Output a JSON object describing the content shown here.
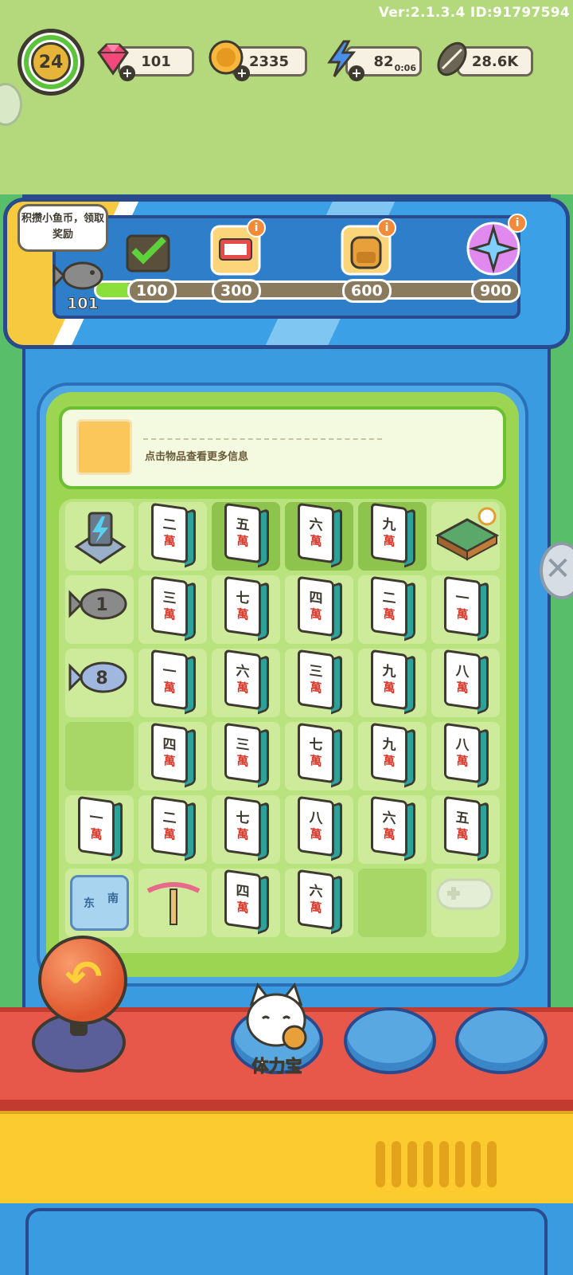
{
  "version": "Ver:2.1.3.4 ID:91797594",
  "player": {
    "level": "24"
  },
  "stats": {
    "gems": "101",
    "coins": "2335",
    "energy": "82",
    "energy_timer": "0:06",
    "seeds": "28.6K"
  },
  "reward_track": {
    "tip": "积攒小鱼币，领取奖励",
    "fish_count": "101",
    "milestones": [
      "100",
      "300",
      "600",
      "900"
    ],
    "progress_fraction": 0.06
  },
  "info_panel": {
    "hint": "点击物品查看更多信息"
  },
  "board": {
    "wan_label": "萬",
    "rows": [
      [
        "charger",
        "二",
        "五",
        "六",
        "九",
        "mahjong-table"
      ],
      [
        "fish-1",
        "三",
        "七",
        "四",
        "二",
        "一"
      ],
      [
        "fish-8",
        "一",
        "六",
        "三",
        "九",
        "八"
      ],
      [
        "empty",
        "四",
        "三",
        "七",
        "九",
        "八"
      ],
      [
        "一",
        "二",
        "七",
        "八",
        "六",
        "五"
      ],
      [
        "fortune-teller",
        "bamboo-dragonfly",
        "四",
        "六",
        "empty",
        "gamepad"
      ]
    ],
    "fortune_teller_labels": [
      "东",
      "南"
    ]
  },
  "controls": {
    "stamina_label": "体力宝"
  }
}
